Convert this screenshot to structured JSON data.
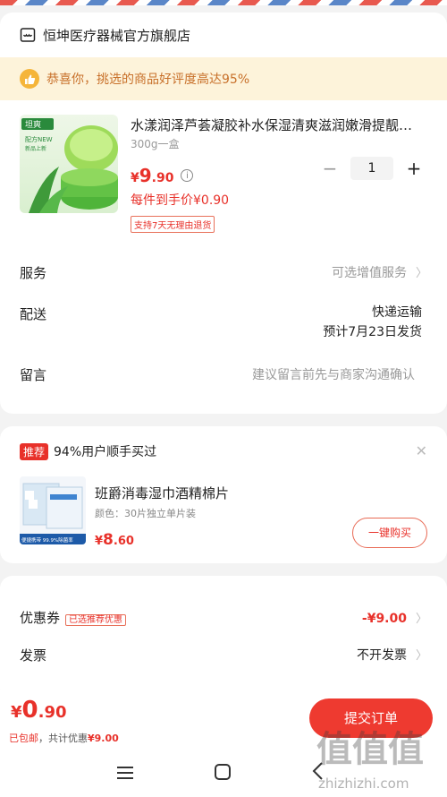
{
  "store": {
    "name": "恒坤医疗器械官方旗舰店"
  },
  "banner": {
    "text": "恭喜你，挑选的商品好评度高达95%"
  },
  "product": {
    "title": "水漾润泽芦荟凝胶补水保湿清爽滋润嫩滑提靓…",
    "spec": "300g一盒",
    "price_currency": "¥",
    "price_int": "9",
    "price_dec": ".90",
    "unit_price": "每件到手价¥0.90",
    "return_badge": "支持7天无理由退货",
    "quantity": "1",
    "image_label_top": "坦爽",
    "image_label_new": "配方NEW",
    "image_label_sub": "新品上新"
  },
  "options": {
    "service_label": "服务",
    "service_value": "可选增值服务",
    "delivery_label": "配送",
    "delivery_method": "快递运输",
    "delivery_date": "预计7月23日发货",
    "message_label": "留言",
    "message_placeholder": "建议留言前先与商家沟通确认"
  },
  "recommend": {
    "tag": "推荐",
    "headline": "94%用户顺手买过",
    "item_name": "班爵消毒湿巾酒精棉片",
    "item_spec": "颜色：30片独立单片装",
    "price_currency": "¥",
    "price_int": "8",
    "price_dec": ".60",
    "buy_label": "一键购买",
    "image_caption": "便捷携带  99.9%除菌率"
  },
  "coupon": {
    "label": "优惠券",
    "badge": "已选推荐优惠",
    "value": "-¥9.00",
    "invoice_label": "发票",
    "invoice_value": "不开发票"
  },
  "bottom": {
    "total_currency": "¥",
    "total_int": "0",
    "total_dec": ".90",
    "shipping": "已包邮",
    "discount_prefix": "，共计优惠",
    "discount_value": "¥9.00",
    "submit_label": "提交订单"
  },
  "watermark": {
    "text": "zhizhizhi.com",
    "glyphs": "值值值"
  },
  "colors": {
    "accent": "#ee3a30",
    "banner_bg": "#fdf3da",
    "banner_text": "#c8702a"
  },
  "icons": [
    "store-icon",
    "thumbs-up-icon",
    "info-icon",
    "minus-icon",
    "plus-icon",
    "chevron-right-icon",
    "close-icon",
    "menu-icon",
    "home-icon",
    "back-icon"
  ]
}
